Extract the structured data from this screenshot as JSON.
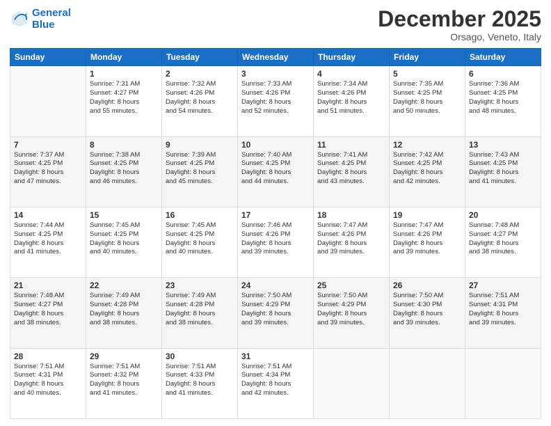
{
  "header": {
    "logo_line1": "General",
    "logo_line2": "Blue",
    "month": "December 2025",
    "location": "Orsago, Veneto, Italy"
  },
  "weekdays": [
    "Sunday",
    "Monday",
    "Tuesday",
    "Wednesday",
    "Thursday",
    "Friday",
    "Saturday"
  ],
  "weeks": [
    [
      {
        "num": "",
        "info": ""
      },
      {
        "num": "1",
        "info": "Sunrise: 7:31 AM\nSunset: 4:27 PM\nDaylight: 8 hours\nand 55 minutes."
      },
      {
        "num": "2",
        "info": "Sunrise: 7:32 AM\nSunset: 4:26 PM\nDaylight: 8 hours\nand 54 minutes."
      },
      {
        "num": "3",
        "info": "Sunrise: 7:33 AM\nSunset: 4:26 PM\nDaylight: 8 hours\nand 52 minutes."
      },
      {
        "num": "4",
        "info": "Sunrise: 7:34 AM\nSunset: 4:26 PM\nDaylight: 8 hours\nand 51 minutes."
      },
      {
        "num": "5",
        "info": "Sunrise: 7:35 AM\nSunset: 4:25 PM\nDaylight: 8 hours\nand 50 minutes."
      },
      {
        "num": "6",
        "info": "Sunrise: 7:36 AM\nSunset: 4:25 PM\nDaylight: 8 hours\nand 48 minutes."
      }
    ],
    [
      {
        "num": "7",
        "info": "Sunrise: 7:37 AM\nSunset: 4:25 PM\nDaylight: 8 hours\nand 47 minutes."
      },
      {
        "num": "8",
        "info": "Sunrise: 7:38 AM\nSunset: 4:25 PM\nDaylight: 8 hours\nand 46 minutes."
      },
      {
        "num": "9",
        "info": "Sunrise: 7:39 AM\nSunset: 4:25 PM\nDaylight: 8 hours\nand 45 minutes."
      },
      {
        "num": "10",
        "info": "Sunrise: 7:40 AM\nSunset: 4:25 PM\nDaylight: 8 hours\nand 44 minutes."
      },
      {
        "num": "11",
        "info": "Sunrise: 7:41 AM\nSunset: 4:25 PM\nDaylight: 8 hours\nand 43 minutes."
      },
      {
        "num": "12",
        "info": "Sunrise: 7:42 AM\nSunset: 4:25 PM\nDaylight: 8 hours\nand 42 minutes."
      },
      {
        "num": "13",
        "info": "Sunrise: 7:43 AM\nSunset: 4:25 PM\nDaylight: 8 hours\nand 41 minutes."
      }
    ],
    [
      {
        "num": "14",
        "info": "Sunrise: 7:44 AM\nSunset: 4:25 PM\nDaylight: 8 hours\nand 41 minutes."
      },
      {
        "num": "15",
        "info": "Sunrise: 7:45 AM\nSunset: 4:25 PM\nDaylight: 8 hours\nand 40 minutes."
      },
      {
        "num": "16",
        "info": "Sunrise: 7:45 AM\nSunset: 4:25 PM\nDaylight: 8 hours\nand 40 minutes."
      },
      {
        "num": "17",
        "info": "Sunrise: 7:46 AM\nSunset: 4:26 PM\nDaylight: 8 hours\nand 39 minutes."
      },
      {
        "num": "18",
        "info": "Sunrise: 7:47 AM\nSunset: 4:26 PM\nDaylight: 8 hours\nand 39 minutes."
      },
      {
        "num": "19",
        "info": "Sunrise: 7:47 AM\nSunset: 4:26 PM\nDaylight: 8 hours\nand 39 minutes."
      },
      {
        "num": "20",
        "info": "Sunrise: 7:48 AM\nSunset: 4:27 PM\nDaylight: 8 hours\nand 38 minutes."
      }
    ],
    [
      {
        "num": "21",
        "info": "Sunrise: 7:48 AM\nSunset: 4:27 PM\nDaylight: 8 hours\nand 38 minutes."
      },
      {
        "num": "22",
        "info": "Sunrise: 7:49 AM\nSunset: 4:28 PM\nDaylight: 8 hours\nand 38 minutes."
      },
      {
        "num": "23",
        "info": "Sunrise: 7:49 AM\nSunset: 4:28 PM\nDaylight: 8 hours\nand 38 minutes."
      },
      {
        "num": "24",
        "info": "Sunrise: 7:50 AM\nSunset: 4:29 PM\nDaylight: 8 hours\nand 39 minutes."
      },
      {
        "num": "25",
        "info": "Sunrise: 7:50 AM\nSunset: 4:29 PM\nDaylight: 8 hours\nand 39 minutes."
      },
      {
        "num": "26",
        "info": "Sunrise: 7:50 AM\nSunset: 4:30 PM\nDaylight: 8 hours\nand 39 minutes."
      },
      {
        "num": "27",
        "info": "Sunrise: 7:51 AM\nSunset: 4:31 PM\nDaylight: 8 hours\nand 39 minutes."
      }
    ],
    [
      {
        "num": "28",
        "info": "Sunrise: 7:51 AM\nSunset: 4:31 PM\nDaylight: 8 hours\nand 40 minutes."
      },
      {
        "num": "29",
        "info": "Sunrise: 7:51 AM\nSunset: 4:32 PM\nDaylight: 8 hours\nand 41 minutes."
      },
      {
        "num": "30",
        "info": "Sunrise: 7:51 AM\nSunset: 4:33 PM\nDaylight: 8 hours\nand 41 minutes."
      },
      {
        "num": "31",
        "info": "Sunrise: 7:51 AM\nSunset: 4:34 PM\nDaylight: 8 hours\nand 42 minutes."
      },
      {
        "num": "",
        "info": ""
      },
      {
        "num": "",
        "info": ""
      },
      {
        "num": "",
        "info": ""
      }
    ]
  ]
}
